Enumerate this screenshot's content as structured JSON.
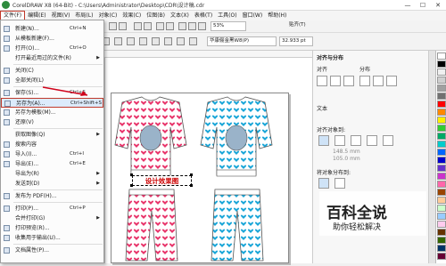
{
  "window": {
    "title": "CorelDRAW X8 (64-Bit) - C:\\Users\\Administrator\\Desktop\\CDR\\设计稿.cdr",
    "minimize": "—",
    "maximize": "☐",
    "close": "✕"
  },
  "menubar": [
    "文件(F)",
    "编辑(E)",
    "视图(V)",
    "布局(L)",
    "对象(C)",
    "效果(C)",
    "位图(B)",
    "文本(X)",
    "表格(T)",
    "工具(O)",
    "窗口(W)",
    "帮助(H)"
  ],
  "toolbar": {
    "zoom": "53%",
    "snap": "贴齐(T)",
    "font": "华康俪金黑W8(P)",
    "font_size": "32.933 pt"
  },
  "file_menu": [
    {
      "label": "新建(N)...",
      "shortcut": "Ctrl+N",
      "icon": "new-doc-icon"
    },
    {
      "label": "从模板新建(F)...",
      "shortcut": "",
      "icon": "template-icon"
    },
    {
      "label": "打开(O)...",
      "shortcut": "Ctrl+O",
      "icon": "open-folder-icon"
    },
    {
      "label": "打开最近用过的文件(R)",
      "shortcut": "",
      "icon": "",
      "submenu": true
    },
    {
      "sep": true
    },
    {
      "label": "关闭(C)",
      "shortcut": "",
      "icon": "close-doc-icon"
    },
    {
      "label": "全部关闭(L)",
      "shortcut": "",
      "icon": "close-all-icon"
    },
    {
      "sep": true
    },
    {
      "label": "保存(S)...",
      "shortcut": "Ctrl+S",
      "icon": "save-icon"
    },
    {
      "label": "另存为(A)...",
      "shortcut": "Ctrl+Shift+S",
      "icon": "save-as-icon",
      "highlighted": true
    },
    {
      "label": "另存为模板(M)...",
      "shortcut": "",
      "icon": "save-template-icon"
    },
    {
      "label": "还原(V)",
      "shortcut": "",
      "icon": "revert-icon"
    },
    {
      "sep": true
    },
    {
      "label": "获取图像(Q)",
      "shortcut": "",
      "icon": "",
      "submenu": true
    },
    {
      "label": "搜索内容",
      "shortcut": "",
      "icon": "search-content-icon"
    },
    {
      "label": "导入(I)...",
      "shortcut": "Ctrl+I",
      "icon": "import-icon"
    },
    {
      "label": "导出(E)...",
      "shortcut": "Ctrl+E",
      "icon": "export-icon"
    },
    {
      "label": "导出为(R)",
      "shortcut": "",
      "icon": "",
      "submenu": true
    },
    {
      "label": "发送到(D)",
      "shortcut": "",
      "icon": "",
      "submenu": true
    },
    {
      "sep": true
    },
    {
      "label": "发布为 PDF(H)...",
      "shortcut": "",
      "icon": "pdf-icon"
    },
    {
      "sep": true
    },
    {
      "label": "打印(P)...",
      "shortcut": "Ctrl+P",
      "icon": "print-icon"
    },
    {
      "label": "合并打印(G)",
      "shortcut": "",
      "icon": "",
      "submenu": true
    },
    {
      "label": "打印预览(R)...",
      "shortcut": "",
      "icon": "print-preview-icon"
    },
    {
      "label": "收集用于输出(U)...",
      "shortcut": "",
      "icon": "collect-output-icon"
    },
    {
      "sep": true
    },
    {
      "label": "文档属性(P)...",
      "shortcut": "",
      "icon": "doc-properties-icon"
    }
  ],
  "canvas": {
    "label": "设计效果图"
  },
  "docker": {
    "panel_title": "对齐与分布",
    "align_label": "对齐",
    "distribute_label": "分布",
    "text_label": "文本",
    "align_to_label": "对齐对象到:",
    "x_value": "148.5 mm",
    "y_value": "105.0 mm",
    "distribute_to_label": "将对象分布到:"
  },
  "palette": [
    "#ffffff",
    "#000000",
    "#f0f0f0",
    "#cfcfcf",
    "#a0a0a0",
    "#707070",
    "#ff0000",
    "#ff8800",
    "#ffee00",
    "#33cc33",
    "#00aa66",
    "#00cccc",
    "#0066ff",
    "#0000cc",
    "#6633cc",
    "#cc33cc",
    "#ff66aa",
    "#994400",
    "#ffcc99",
    "#ccffcc",
    "#99ccff",
    "#ffccee",
    "#663300",
    "#336600",
    "#003366",
    "#660033"
  ],
  "watermark": {
    "title": "百科全说",
    "subtitle": "助你轻松解决"
  }
}
